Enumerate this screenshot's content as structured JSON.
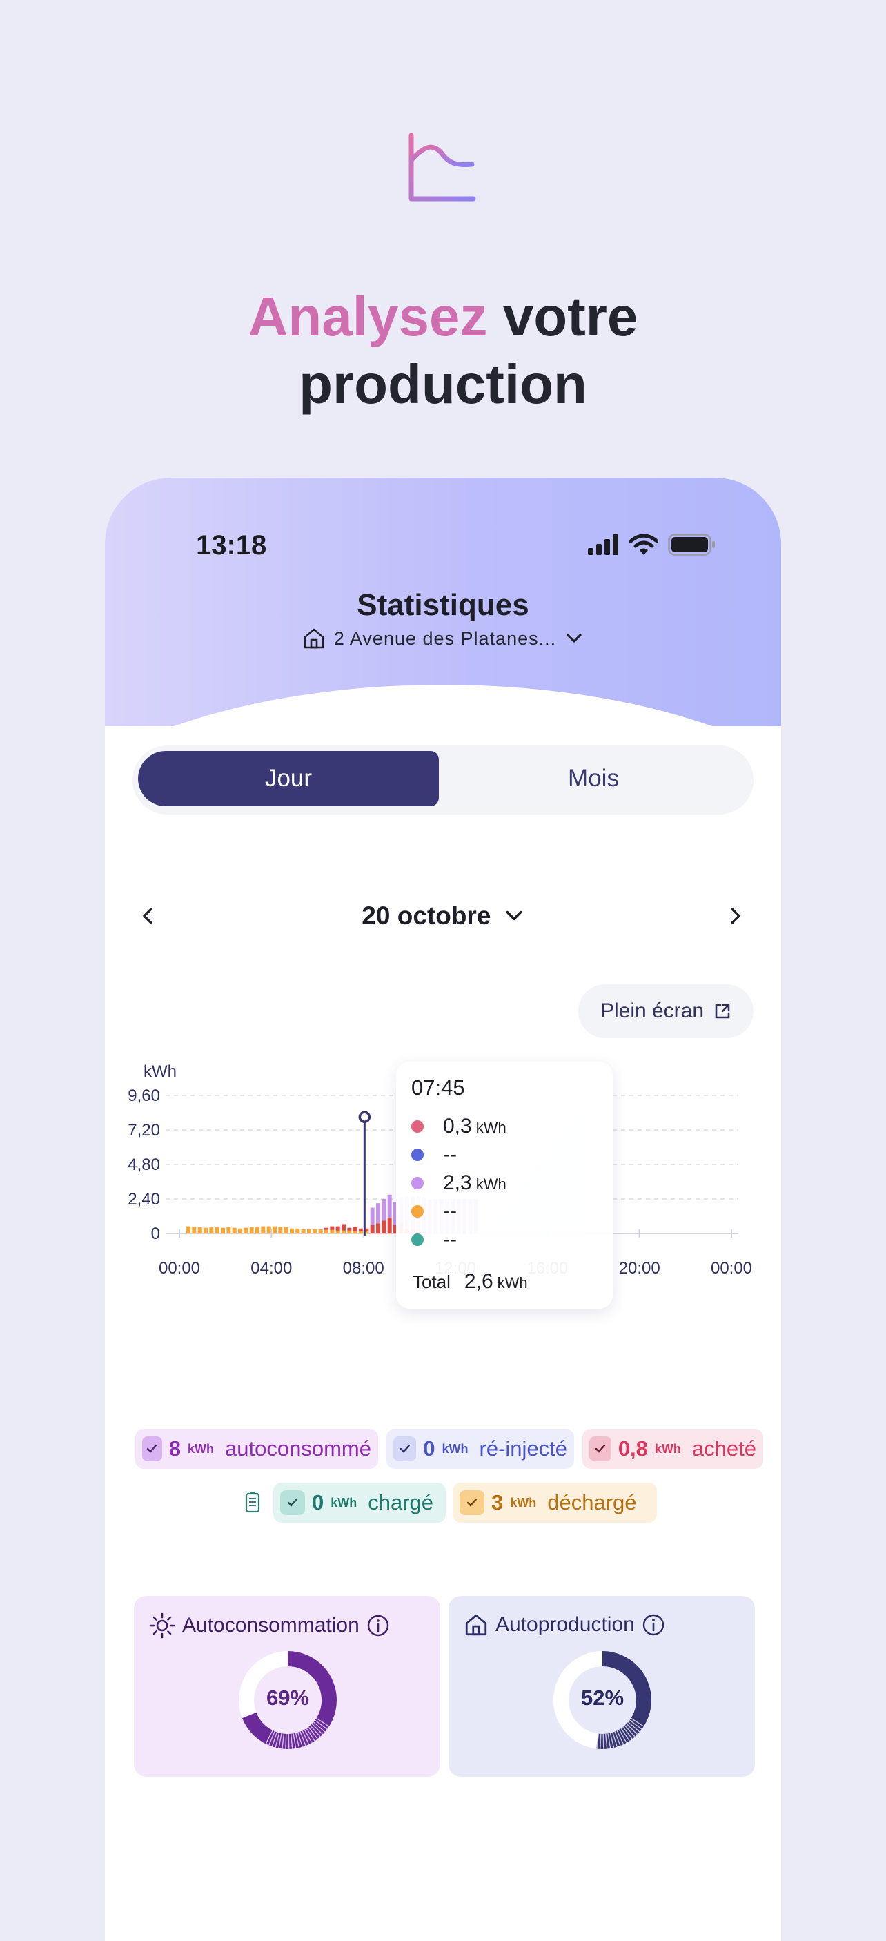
{
  "hero": {
    "icon": "chart-analytics-icon",
    "headline_accent": "Analysez",
    "headline_rest": "votre",
    "headline_line2": "production"
  },
  "status_bar": {
    "time": "13:18",
    "icons": [
      "signal-icon",
      "wifi-icon",
      "battery-icon"
    ]
  },
  "header": {
    "title": "Statistiques",
    "address": "2 Avenue des Platanes...",
    "address_icon": "home-icon"
  },
  "tabs": [
    {
      "label": "Jour",
      "active": true
    },
    {
      "label": "Mois",
      "active": false
    }
  ],
  "date_nav": {
    "label": "20 octobre"
  },
  "fullscreen": {
    "label": "Plein écran"
  },
  "colors": {
    "accent_dark": "#393774",
    "autoconsomme": "#c693ee",
    "reinjecte": "#5a67db",
    "achete": "#e0637e",
    "charge": "#3fa79a",
    "decharge": "#f5a73b",
    "grid_red": "#e0493f"
  },
  "chart_data": {
    "type": "bar",
    "stacked": true,
    "ylabel": "kWh",
    "y_ticks": [
      "9,60",
      "7,20",
      "4,80",
      "2,40",
      "0"
    ],
    "ylim": [
      0,
      9.6
    ],
    "x_ticks": [
      "00:00",
      "04:00",
      "08:00",
      "12:00",
      "16:00",
      "20:00",
      "00:00"
    ],
    "interval_minutes": 15,
    "grid": true,
    "series": [
      {
        "key": "decharge",
        "values": [
          0.5,
          0.45,
          0.45,
          0.4,
          0.45,
          0.45,
          0.4,
          0.45,
          0.4,
          0.35,
          0.4,
          0.45,
          0.45,
          0.5,
          0.5,
          0.5,
          0.45,
          0.45,
          0.35,
          0.35,
          0.3,
          0.3,
          0.3,
          0.3,
          0.25,
          0.25,
          0.2,
          0.2,
          0.2,
          0.15,
          0.15,
          0.15,
          0,
          0,
          0,
          0,
          0,
          0,
          0,
          0,
          0,
          0,
          0,
          0,
          0,
          0,
          0,
          0,
          0,
          0,
          0
        ]
      },
      {
        "key": "achete",
        "values": [
          0,
          0,
          0,
          0,
          0,
          0,
          0,
          0,
          0,
          0,
          0,
          0,
          0,
          0,
          0,
          0,
          0,
          0,
          0,
          0,
          0,
          0,
          0,
          0,
          0.15,
          0.25,
          0.3,
          0.45,
          0.2,
          0.3,
          0.2,
          0.2,
          0.6,
          0.7,
          0.9,
          1.1,
          0.6,
          0.7,
          0.35,
          0.3,
          0.2,
          0.1,
          0,
          0,
          0,
          0,
          0,
          0,
          0,
          0,
          0
        ]
      },
      {
        "key": "autoconsomme",
        "values": [
          0,
          0,
          0,
          0,
          0,
          0,
          0,
          0,
          0,
          0,
          0,
          0,
          0,
          0,
          0,
          0,
          0,
          0,
          0,
          0,
          0,
          0,
          0,
          0,
          0,
          0,
          0,
          0,
          0,
          0,
          0,
          0,
          1.2,
          1.4,
          1.5,
          1.6,
          1.6,
          1.8,
          2.2,
          2.3,
          2.4,
          2.4,
          2.4,
          2.4,
          2.4,
          2.4,
          2.4,
          2.4,
          2.4,
          2.4,
          2.4
        ]
      }
    ],
    "faded_series": {
      "key": "future",
      "values": [
        0.5,
        0.6,
        0.8,
        1.2,
        1.8,
        2.4,
        2.8,
        3.2,
        3.6,
        4.3,
        5.1,
        5.6,
        6.2,
        6.8,
        7.4,
        7.9,
        8.4,
        8.8
      ]
    },
    "cursor": {
      "time": "07:45",
      "value": 8.1
    },
    "tooltip": {
      "time": "07:45",
      "rows": [
        {
          "color": "#e0637e",
          "value": "0,3",
          "unit": "kWh"
        },
        {
          "color": "#5a67db",
          "value": "--",
          "unit": ""
        },
        {
          "color": "#c693ee",
          "value": "2,3",
          "unit": "kWh"
        },
        {
          "color": "#f5a73b",
          "value": "--",
          "unit": ""
        },
        {
          "color": "#3fa79a",
          "value": "--",
          "unit": ""
        }
      ],
      "total_label": "Total",
      "total_value": "2,6",
      "total_unit": "kWh"
    }
  },
  "legend": {
    "battery_icon": "battery-icon",
    "items": [
      {
        "value": "8",
        "unit": "kWh",
        "label": "autoconsommé"
      },
      {
        "value": "0",
        "unit": "kWh",
        "label": "ré-injecté"
      },
      {
        "value": "0,8",
        "unit": "kWh",
        "label": "acheté"
      },
      {
        "value": "0",
        "unit": "kWh",
        "label": "chargé"
      },
      {
        "value": "3",
        "unit": "kWh",
        "label": "déchargé"
      }
    ]
  },
  "cards": [
    {
      "title": "Autoconsommation",
      "icon": "sun-icon",
      "value": "69%",
      "percent": 69,
      "color": "#6a2a9a"
    },
    {
      "title": "Autoproduction",
      "icon": "home-icon",
      "value": "52%",
      "percent": 52,
      "color": "#363673"
    }
  ]
}
